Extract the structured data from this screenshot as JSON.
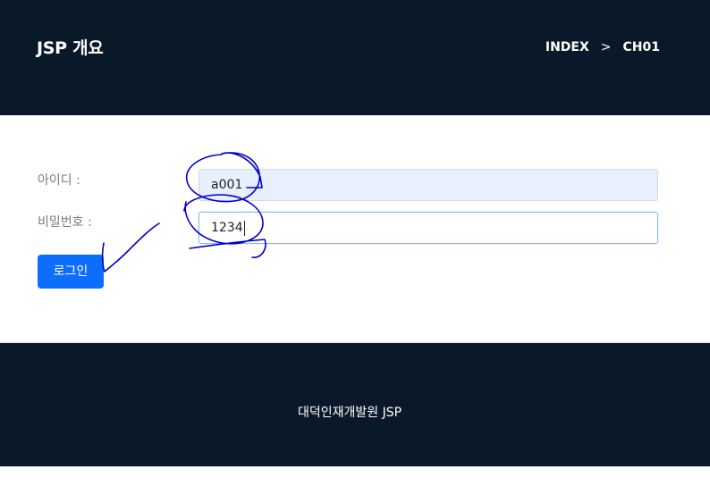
{
  "header": {
    "brand": "JSP 개요",
    "breadcrumb": [
      "INDEX",
      "CH01"
    ],
    "breadcrumb_separator": ">"
  },
  "form": {
    "id_label": "아이디 :",
    "id_value": "a001",
    "pw_label": "비밀번호 :",
    "pw_value": "1234",
    "login_button": "로그인"
  },
  "footer": {
    "text": "대덕인재개발원 JSP"
  },
  "colors": {
    "header_bg": "#0a1929",
    "button": "#0d6efd",
    "annotation": "#0000cc"
  }
}
